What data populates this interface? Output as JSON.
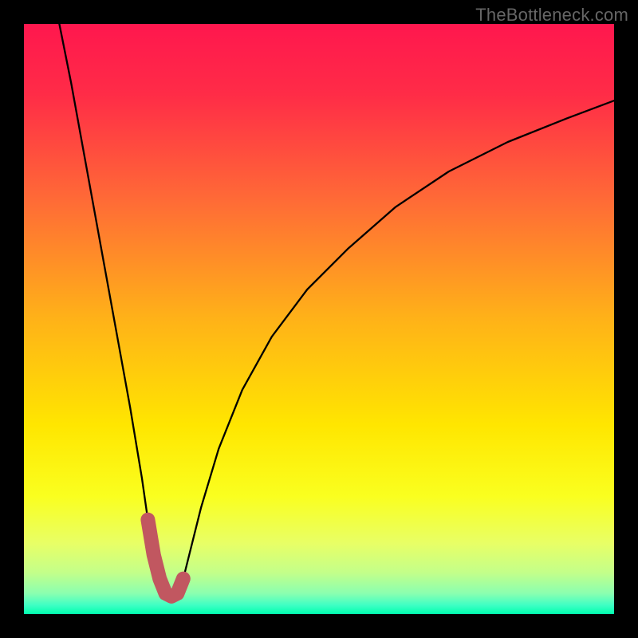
{
  "watermark": {
    "text": "TheBottleneck.com"
  },
  "colors": {
    "frame": "#000000",
    "curve_stroke": "#000000",
    "highlight": "#c15760",
    "gradient_stops": [
      {
        "offset": 0.0,
        "color": "#ff174e"
      },
      {
        "offset": 0.12,
        "color": "#ff2c47"
      },
      {
        "offset": 0.3,
        "color": "#ff6b36"
      },
      {
        "offset": 0.5,
        "color": "#ffb218"
      },
      {
        "offset": 0.68,
        "color": "#ffe600"
      },
      {
        "offset": 0.8,
        "color": "#faff1f"
      },
      {
        "offset": 0.88,
        "color": "#e8ff66"
      },
      {
        "offset": 0.93,
        "color": "#c3ff8a"
      },
      {
        "offset": 0.965,
        "color": "#8affb0"
      },
      {
        "offset": 0.985,
        "color": "#3effc4"
      },
      {
        "offset": 1.0,
        "color": "#00ffae"
      }
    ]
  },
  "chart_data": {
    "type": "line",
    "title": "",
    "xlabel": "",
    "ylabel": "",
    "xlim": [
      0,
      100
    ],
    "ylim": [
      0,
      100
    ],
    "grid": false,
    "legend": false,
    "note": "Qualitative bottleneck-style curve on a heatmap gradient. Values estimated from pixel positions; the chart has no axis ticks or numeric labels.",
    "series": [
      {
        "name": "curve",
        "x": [
          6,
          8,
          10,
          12,
          14,
          16,
          18,
          20,
          21,
          22,
          23,
          24,
          25,
          26,
          27,
          28,
          30,
          33,
          37,
          42,
          48,
          55,
          63,
          72,
          82,
          92,
          100
        ],
        "y": [
          100,
          90,
          79,
          68,
          57,
          46,
          35,
          23,
          16,
          10,
          6,
          3.5,
          3,
          3.5,
          6,
          10,
          18,
          28,
          38,
          47,
          55,
          62,
          69,
          75,
          80,
          84,
          87
        ]
      }
    ],
    "highlight_region": {
      "name": "valley-highlight",
      "x": [
        21,
        22,
        23,
        24,
        25,
        26,
        27
      ],
      "y": [
        16,
        10,
        6,
        3.5,
        3,
        3.5,
        6,
        10
      ]
    }
  }
}
